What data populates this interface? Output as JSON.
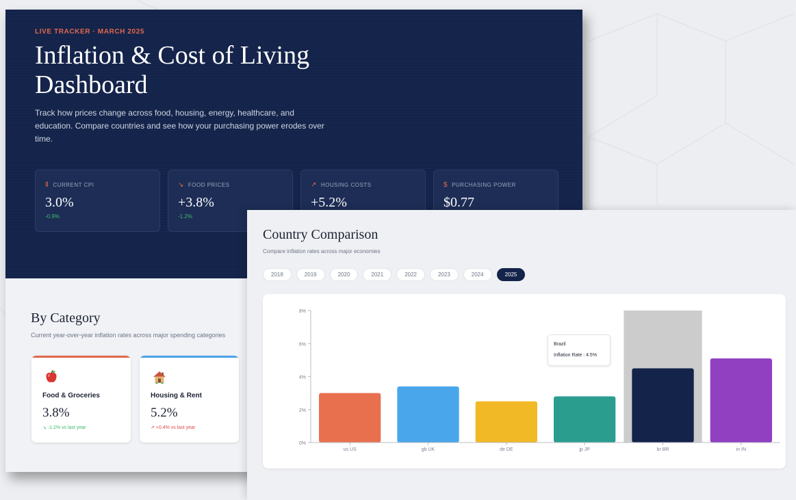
{
  "hero": {
    "eyebrow": "LIVE TRACKER · MARCH 2025",
    "title": "Inflation & Cost of Living Dashboard",
    "description": "Track how prices change across food, housing, energy, healthcare, and education. Compare countries and see how your purchasing power erodes over time."
  },
  "stats": [
    {
      "icon": "bar-chart-icon",
      "glyph": "Ⅱ",
      "label": "CURRENT CPI",
      "value": "3.0%",
      "delta": "-0.9%"
    },
    {
      "icon": "trend-down-icon",
      "glyph": "↘",
      "label": "FOOD PRICES",
      "value": "+3.8%",
      "delta": "-1.2%"
    },
    {
      "icon": "trend-up-icon",
      "glyph": "↗",
      "label": "HOUSING COSTS",
      "value": "+5.2%",
      "delta": ""
    },
    {
      "icon": "dollar-icon",
      "glyph": "$",
      "label": "PURCHASING POWER",
      "value": "$0.77",
      "delta": ""
    }
  ],
  "category": {
    "title": "By Category",
    "subtitle": "Current year-over-year inflation rates across major spending categories",
    "cards": [
      {
        "icon": "apple-icon",
        "name": "Food & Groceries",
        "value": "3.8%",
        "delta": "↘ -1.2% vs last year",
        "accent": "#e0674c",
        "delta_color": "#3dbb6b"
      },
      {
        "icon": "house-icon",
        "name": "Housing & Rent",
        "value": "5.2%",
        "delta": "↗ +0.4% vs last year",
        "accent": "#4aa3e8",
        "delta_color": "#e04848"
      }
    ]
  },
  "comparison": {
    "title": "Country Comparison",
    "subtitle": "Compare inflation rates across major economies",
    "years": [
      "2018",
      "2019",
      "2020",
      "2021",
      "2022",
      "2023",
      "2024",
      "2025"
    ],
    "active_year": "2025",
    "tooltip": {
      "country": "Brazil",
      "label": "Inflation Rate",
      "sep": " : ",
      "value": "4.5%"
    }
  },
  "chart_data": {
    "type": "bar",
    "categories": [
      "US",
      "UK",
      "DE",
      "JP",
      "BR",
      "IN"
    ],
    "tick_labels": [
      "us US",
      "gb UK",
      "de DE",
      "jp JP",
      "br BR",
      "in IN"
    ],
    "values": [
      3.0,
      3.4,
      2.5,
      2.8,
      4.5,
      5.1
    ],
    "colors": [
      "#e8704f",
      "#4aa6ea",
      "#f2b926",
      "#2a9d8f",
      "#14234a",
      "#9140c2"
    ],
    "ylim": [
      0,
      8
    ],
    "yticks": [
      "0%",
      "2%",
      "4%",
      "6%",
      "8%"
    ],
    "highlighted_category": "BR",
    "grid": false,
    "title": "",
    "xlabel": "",
    "ylabel": ""
  },
  "colors": {
    "navy": "#14234a",
    "accent": "#e0674c",
    "positive": "#3dbb6b",
    "negative": "#e04848"
  }
}
